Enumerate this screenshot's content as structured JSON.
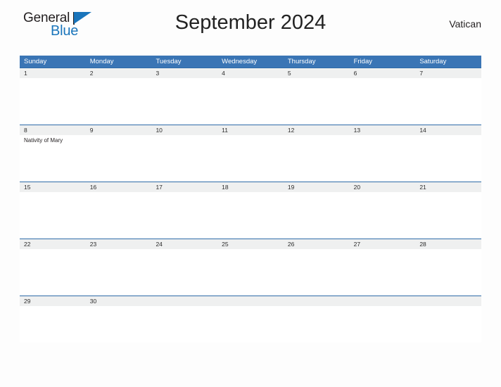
{
  "branding": {
    "logo_text_1": "General",
    "logo_text_2": "Blue",
    "logo_flag_icon": "triangle-flag-icon",
    "logo_color": "#1a75bb"
  },
  "header": {
    "title": "September 2024",
    "region": "Vatican"
  },
  "theme": {
    "header_bar_color": "#3a75b5",
    "row_rule_color": "#2e6ba8",
    "date_band_color": "#eff0f0",
    "title_color": "#222222"
  },
  "calendar": {
    "weekdays": [
      "Sunday",
      "Monday",
      "Tuesday",
      "Wednesday",
      "Thursday",
      "Friday",
      "Saturday"
    ],
    "weeks": [
      {
        "days": [
          {
            "date": "1",
            "events": []
          },
          {
            "date": "2",
            "events": []
          },
          {
            "date": "3",
            "events": []
          },
          {
            "date": "4",
            "events": []
          },
          {
            "date": "5",
            "events": []
          },
          {
            "date": "6",
            "events": []
          },
          {
            "date": "7",
            "events": []
          }
        ]
      },
      {
        "days": [
          {
            "date": "8",
            "events": [
              "Nativity of Mary"
            ]
          },
          {
            "date": "9",
            "events": []
          },
          {
            "date": "10",
            "events": []
          },
          {
            "date": "11",
            "events": []
          },
          {
            "date": "12",
            "events": []
          },
          {
            "date": "13",
            "events": []
          },
          {
            "date": "14",
            "events": []
          }
        ]
      },
      {
        "days": [
          {
            "date": "15",
            "events": []
          },
          {
            "date": "16",
            "events": []
          },
          {
            "date": "17",
            "events": []
          },
          {
            "date": "18",
            "events": []
          },
          {
            "date": "19",
            "events": []
          },
          {
            "date": "20",
            "events": []
          },
          {
            "date": "21",
            "events": []
          }
        ]
      },
      {
        "days": [
          {
            "date": "22",
            "events": []
          },
          {
            "date": "23",
            "events": []
          },
          {
            "date": "24",
            "events": []
          },
          {
            "date": "25",
            "events": []
          },
          {
            "date": "26",
            "events": []
          },
          {
            "date": "27",
            "events": []
          },
          {
            "date": "28",
            "events": []
          }
        ]
      },
      {
        "days": [
          {
            "date": "29",
            "events": []
          },
          {
            "date": "30",
            "events": []
          },
          {
            "date": "",
            "events": []
          },
          {
            "date": "",
            "events": []
          },
          {
            "date": "",
            "events": []
          },
          {
            "date": "",
            "events": []
          },
          {
            "date": "",
            "events": []
          }
        ]
      }
    ]
  }
}
